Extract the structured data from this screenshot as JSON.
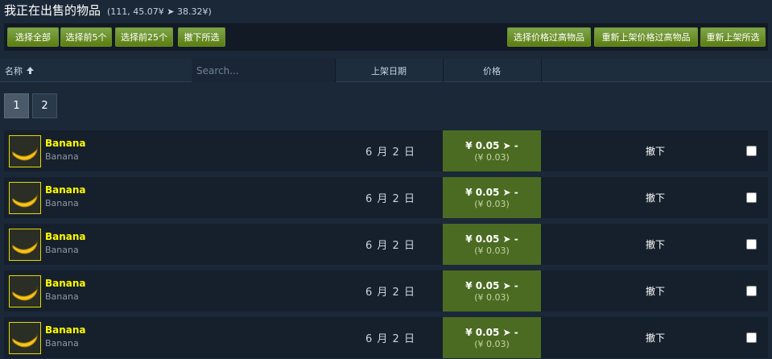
{
  "header": {
    "title": "我正在出售的物品",
    "summary": "(111, 45.07¥ ➤ 38.32¥)"
  },
  "toolbar": {
    "select_all": "选择全部",
    "select_first_5": "选择前5个",
    "select_first_25": "选择前25个",
    "delist_selected": "撤下所选",
    "select_overpriced": "选择价格过高物品",
    "relist_overpriced": "重新上架价格过高物品",
    "relist_selected": "重新上架所选"
  },
  "table": {
    "col_name": "名称",
    "sort_icon": "sort-up-arrow-icon",
    "search_placeholder": "Search...",
    "col_listed_date": "上架日期",
    "col_price": "价格"
  },
  "pagination": {
    "pages": [
      "1",
      "2"
    ],
    "current": "1"
  },
  "listings": [
    {
      "name": "Banana",
      "game": "Banana",
      "date": "6 月 2 日",
      "price": "¥ 0.05 ➤ -",
      "receive": "(¥ 0.03)",
      "action": "撤下"
    },
    {
      "name": "Banana",
      "game": "Banana",
      "date": "6 月 2 日",
      "price": "¥ 0.05 ➤ -",
      "receive": "(¥ 0.03)",
      "action": "撤下"
    },
    {
      "name": "Banana",
      "game": "Banana",
      "date": "6 月 2 日",
      "price": "¥ 0.05 ➤ -",
      "receive": "(¥ 0.03)",
      "action": "撤下"
    },
    {
      "name": "Banana",
      "game": "Banana",
      "date": "6 月 2 日",
      "price": "¥ 0.05 ➤ -",
      "receive": "(¥ 0.03)",
      "action": "撤下"
    },
    {
      "name": "Banana",
      "game": "Banana",
      "date": "6 月 2 日",
      "price": "¥ 0.05 ➤ -",
      "receive": "(¥ 0.03)",
      "action": "撤下"
    }
  ],
  "colors": {
    "background": "#1b2838",
    "button_green": "#5c7e10",
    "price_cell": "#4c6b22",
    "item_name": "#fffa00"
  }
}
